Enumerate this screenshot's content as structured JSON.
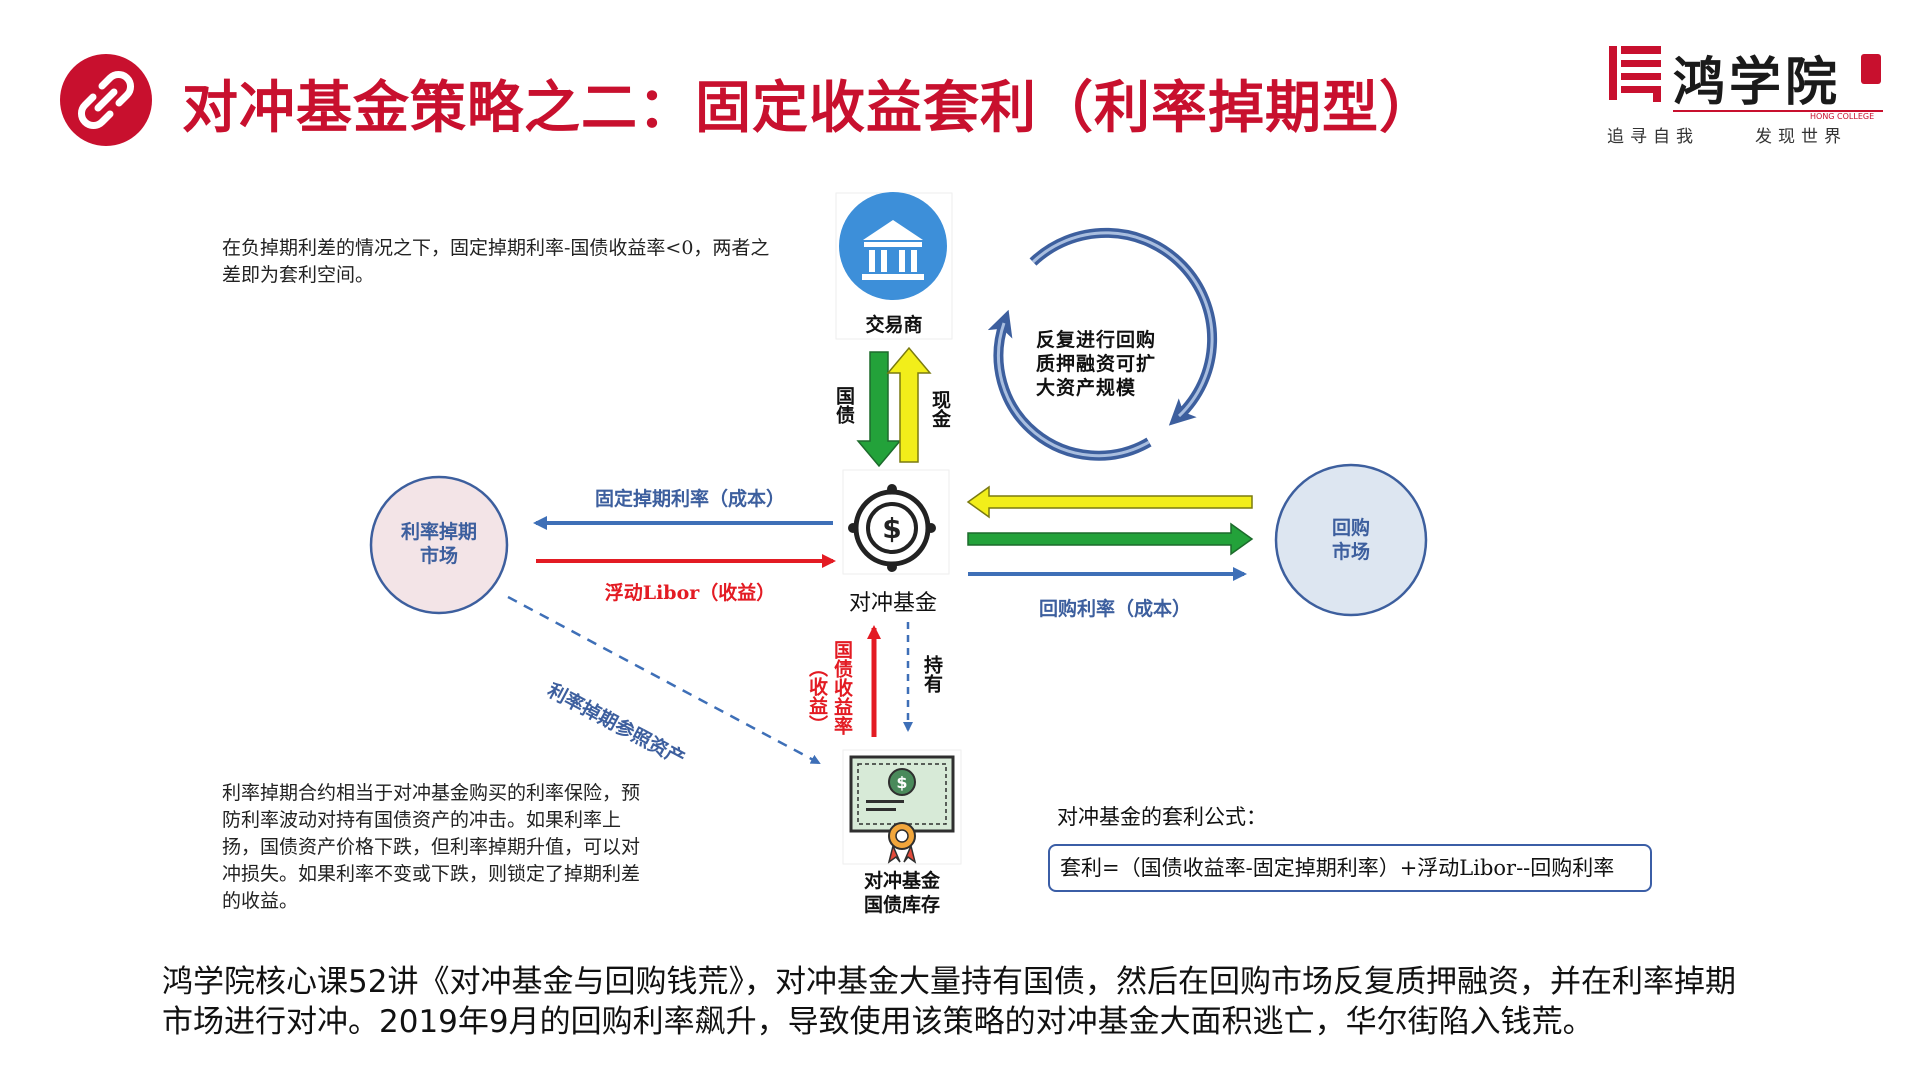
{
  "title": "对冲基金策略之二：固定收益套利（利率掉期型）",
  "logo": {
    "brand": "鸿学院",
    "english": "HONG COLLEGE",
    "tagline_left": "追寻自我",
    "tagline_right": "发现世界"
  },
  "notes": {
    "top": "在负掉期利差的情况之下，固定掉期利率-国债收益率<0，两者之差即为套利空间。",
    "bottom": "利率掉期合约相当于对冲基金购买的利率保险，预防利率波动对持有国债资产的冲击。如果利率上扬，国债资产价格下跌，但利率掉期升值，可以对冲损失。如果利率不变或下跌，则锁定了掉期利差的收益。"
  },
  "nodes": {
    "dealer": "交易商",
    "hedge_fund": "对冲基金",
    "swap_market": "利率掉期\n市场",
    "repo_market": "回购\n市场",
    "inventory_line1": "对冲基金",
    "inventory_line2": "国债库存"
  },
  "cycle_text": "反复进行回购\n质押融资可扩\n大资产规模",
  "arrow_labels": {
    "bonds": "国债",
    "cash": "现金",
    "fixed_swap": "固定掉期利率（成本）",
    "floating_libor": "浮动Libor（收益）",
    "repo_rate": "回购利率（成本）",
    "bond_yield": "国债收益率",
    "bond_yield_sub": "（收益）",
    "hold": "持有",
    "reference": "利率掉期参照资产"
  },
  "formula": {
    "label": "对冲基金的套利公式：",
    "text": "套利=（国债收益率-固定掉期利率）+浮动Libor--回购利率"
  },
  "footer": "鸿学院核心课52讲《对冲基金与回购钱荒》，对冲基金大量持有国债，然后在回购市场反复质押融资，并在利率掉期市场进行对冲。2019年9月的回购利率飙升，导致使用该策略的对冲基金大面积逃亡，华尔街陷入钱荒。",
  "colors": {
    "title_red": "#c8102e",
    "blue_arrow": "#3e6fb7",
    "red_arrow": "#e31b23",
    "green_arrow": "#23a23a",
    "yellow_arrow": "#f2ee1a",
    "cycle_blue": "#3d5f9e",
    "swap_circle_fill": "#f3e4e7",
    "repo_circle_fill": "#dde6f1",
    "bank_icon_blue": "#3d8fd9"
  }
}
